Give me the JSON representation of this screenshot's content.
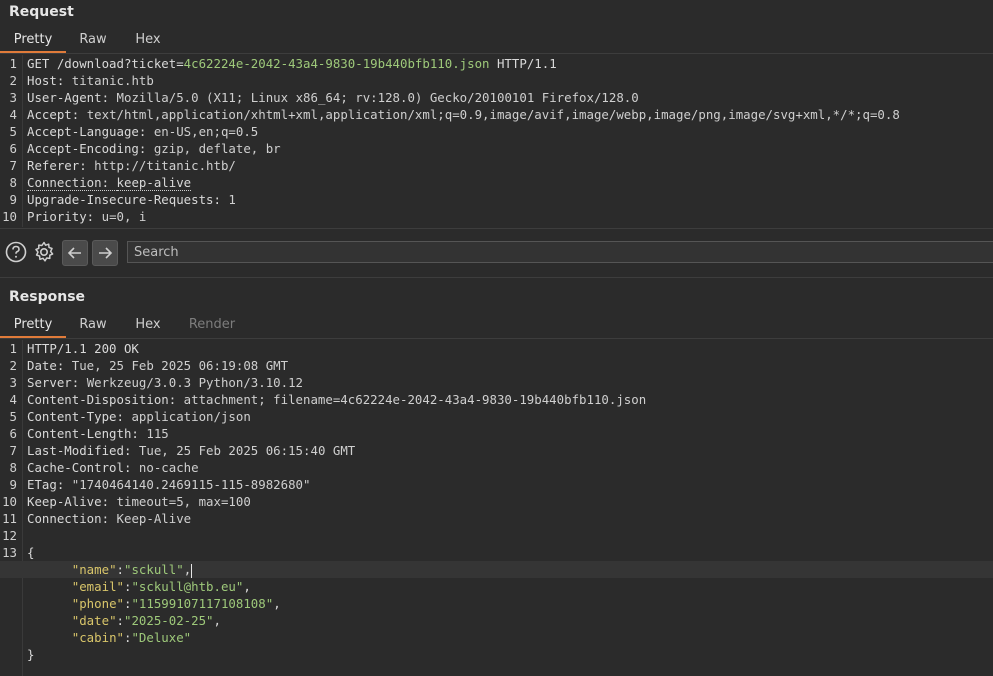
{
  "request": {
    "title": "Request",
    "tabs": [
      "Pretty",
      "Raw",
      "Hex"
    ],
    "lines": [
      {
        "n": "1",
        "parts": [
          [
            "GET /download?ticket=",
            "key"
          ],
          [
            "4c62224e-2042-43a4-9830-19b440bfb110.json",
            "green"
          ],
          [
            " HTTP/1.1",
            "key"
          ]
        ]
      },
      {
        "n": "2",
        "parts": [
          [
            "Host: ",
            "key"
          ],
          [
            "titanic.htb",
            "val"
          ]
        ]
      },
      {
        "n": "3",
        "parts": [
          [
            "User-Agent: ",
            "key"
          ],
          [
            "Mozilla/5.0 (X11; Linux x86_64; rv:128.0) Gecko/20100101 Firefox/128.0",
            "val"
          ]
        ]
      },
      {
        "n": "4",
        "parts": [
          [
            "Accept: ",
            "key"
          ],
          [
            "text/html,application/xhtml+xml,application/xml;q=0.9,image/avif,image/webp,image/png,image/svg+xml,*/*;q=0.8",
            "val"
          ]
        ]
      },
      {
        "n": "5",
        "parts": [
          [
            "Accept-Language: ",
            "key"
          ],
          [
            "en-US,en;q=0.5",
            "val"
          ]
        ]
      },
      {
        "n": "6",
        "parts": [
          [
            "Accept-Encoding: ",
            "key"
          ],
          [
            "gzip, deflate, br",
            "val"
          ]
        ]
      },
      {
        "n": "7",
        "parts": [
          [
            "Referer: ",
            "key"
          ],
          [
            "http://titanic.htb/",
            "val"
          ]
        ]
      },
      {
        "n": "8",
        "parts": [
          [
            "Connection: ",
            "dotted"
          ],
          [
            "keep-alive",
            "dotted"
          ]
        ]
      },
      {
        "n": "9",
        "parts": [
          [
            "Upgrade-Insecure-Requests: ",
            "key"
          ],
          [
            "1",
            "val"
          ]
        ]
      },
      {
        "n": "10",
        "parts": [
          [
            "Priority: ",
            "key"
          ],
          [
            "u=0, i",
            "val"
          ]
        ]
      }
    ]
  },
  "toolbar": {
    "search_placeholder": "Search",
    "help_icon": "help-icon",
    "settings_icon": "gear-icon",
    "back_icon": "arrow-left-icon",
    "forward_icon": "arrow-right-icon"
  },
  "response": {
    "title": "Response",
    "tabs": [
      "Pretty",
      "Raw",
      "Hex",
      "Render"
    ],
    "lines": [
      {
        "n": "1",
        "parts": [
          [
            "HTTP/1.1 200 OK",
            "key"
          ]
        ]
      },
      {
        "n": "2",
        "parts": [
          [
            "Date: ",
            "key"
          ],
          [
            "Tue, 25 Feb 2025 06:19:08 GMT",
            "val"
          ]
        ]
      },
      {
        "n": "3",
        "parts": [
          [
            "Server: ",
            "key"
          ],
          [
            "Werkzeug/3.0.3 Python/3.10.12",
            "val"
          ]
        ]
      },
      {
        "n": "4",
        "parts": [
          [
            "Content-Disposition: ",
            "key"
          ],
          [
            "attachment; filename=4c62224e-2042-43a4-9830-19b440bfb110.json",
            "val"
          ]
        ]
      },
      {
        "n": "5",
        "parts": [
          [
            "Content-Type: ",
            "key"
          ],
          [
            "application/json",
            "val"
          ]
        ]
      },
      {
        "n": "6",
        "parts": [
          [
            "Content-Length: ",
            "key"
          ],
          [
            "115",
            "val"
          ]
        ]
      },
      {
        "n": "7",
        "parts": [
          [
            "Last-Modified: ",
            "key"
          ],
          [
            "Tue, 25 Feb 2025 06:15:40 GMT",
            "val"
          ]
        ]
      },
      {
        "n": "8",
        "parts": [
          [
            "Cache-Control: ",
            "key"
          ],
          [
            "no-cache",
            "val"
          ]
        ]
      },
      {
        "n": "9",
        "parts": [
          [
            "ETag: ",
            "key"
          ],
          [
            "\"1740464140.2469115-115-8982680\"",
            "val"
          ]
        ]
      },
      {
        "n": "10",
        "parts": [
          [
            "Keep-Alive: ",
            "key"
          ],
          [
            "timeout=5, max=100",
            "val"
          ]
        ]
      },
      {
        "n": "11",
        "parts": [
          [
            "Connection: ",
            "key"
          ],
          [
            "Keep-Alive",
            "val"
          ]
        ]
      },
      {
        "n": "12",
        "parts": []
      },
      {
        "n": "13",
        "parts": [
          [
            "{",
            "key"
          ]
        ]
      },
      {
        "n": "",
        "parts": [
          [
            "      ",
            "key"
          ],
          [
            "\"name\"",
            "jkey"
          ],
          [
            ":",
            "key"
          ],
          [
            "\"sckull\"",
            "jstr"
          ],
          [
            ",",
            "key"
          ]
        ],
        "cursor": true,
        "highlight": true
      },
      {
        "n": "",
        "parts": [
          [
            "      ",
            "key"
          ],
          [
            "\"email\"",
            "jkey"
          ],
          [
            ":",
            "key"
          ],
          [
            "\"sckull@htb.eu\"",
            "jstr"
          ],
          [
            ",",
            "key"
          ]
        ]
      },
      {
        "n": "",
        "parts": [
          [
            "      ",
            "key"
          ],
          [
            "\"phone\"",
            "jkey"
          ],
          [
            ":",
            "key"
          ],
          [
            "\"11599107117108108\"",
            "jstr"
          ],
          [
            ",",
            "key"
          ]
        ]
      },
      {
        "n": "",
        "parts": [
          [
            "      ",
            "key"
          ],
          [
            "\"date\"",
            "jkey"
          ],
          [
            ":",
            "key"
          ],
          [
            "\"2025-02-25\"",
            "jstr"
          ],
          [
            ",",
            "key"
          ]
        ]
      },
      {
        "n": "",
        "parts": [
          [
            "      ",
            "key"
          ],
          [
            "\"cabin\"",
            "jkey"
          ],
          [
            ":",
            "key"
          ],
          [
            "\"Deluxe\"",
            "jstr"
          ]
        ]
      },
      {
        "n": "",
        "parts": [
          [
            "}",
            "key"
          ]
        ]
      }
    ]
  }
}
